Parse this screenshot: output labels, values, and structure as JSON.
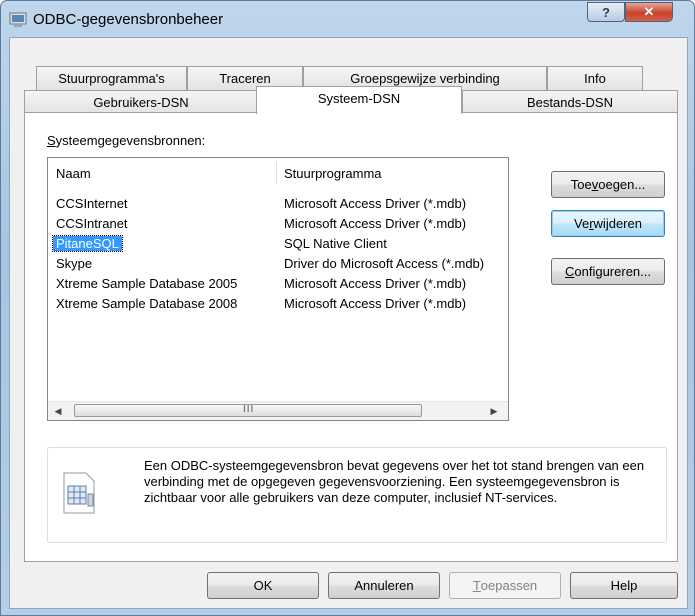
{
  "window": {
    "title": "ODBC-gegevensbronbeheer",
    "help_glyph": "?",
    "close_glyph": "✕"
  },
  "tabs_row1": [
    {
      "label": "Stuurprogramma's"
    },
    {
      "label": "Traceren"
    },
    {
      "label": "Groepsgewijze verbinding"
    },
    {
      "label": "Info"
    }
  ],
  "tabs_row2": [
    {
      "label": "Gebruikers-DSN"
    },
    {
      "label": "Systeem-DSN",
      "active": true
    },
    {
      "label": "Bestands-DSN"
    }
  ],
  "panel": {
    "list_label_accel": "S",
    "list_label_rest": "ysteemgegevensbronnen:",
    "columns": [
      "Naam",
      "Stuurprogramma"
    ],
    "rows": [
      {
        "name": "CCSInternet",
        "driver": "Microsoft Access Driver (*.mdb)"
      },
      {
        "name": "CCSIntranet",
        "driver": "Microsoft Access Driver (*.mdb)"
      },
      {
        "name": "PitaneSQL",
        "driver": "SQL Native Client",
        "selected": true
      },
      {
        "name": "Skype",
        "driver": "Driver do Microsoft Access (*.mdb)"
      },
      {
        "name": "Xtreme Sample Database 2005",
        "driver": "Microsoft Access Driver (*.mdb)"
      },
      {
        "name": "Xtreme Sample Database 2008",
        "driver": "Microsoft Access Driver (*.mdb)"
      }
    ],
    "scroll_left": "◀",
    "scroll_right": "▶",
    "scroll_grip": "III",
    "buttons": {
      "add_pre": "Toe",
      "add_accel": "v",
      "add_post": "oegen...",
      "remove_pre": "Ve",
      "remove_accel": "r",
      "remove_post": "wijderen",
      "configure_pre": "",
      "configure_accel": "C",
      "configure_post": "onfigureren..."
    },
    "info_text": "Een ODBC-systeemgegevensbron bevat gegevens over het tot stand brengen van een verbinding met de opgegeven gegevensvoorziening. Een systeemgegevensbron is zichtbaar voor alle gebruikers van deze computer, inclusief NT-services."
  },
  "footer": {
    "ok": "OK",
    "cancel": "Annuleren",
    "apply_accel": "T",
    "apply_rest": "oepassen",
    "help": "Help"
  },
  "colors": {
    "selection": "#3399ff",
    "titlebar": "#b5cde6",
    "close_red": "#c7432b"
  }
}
